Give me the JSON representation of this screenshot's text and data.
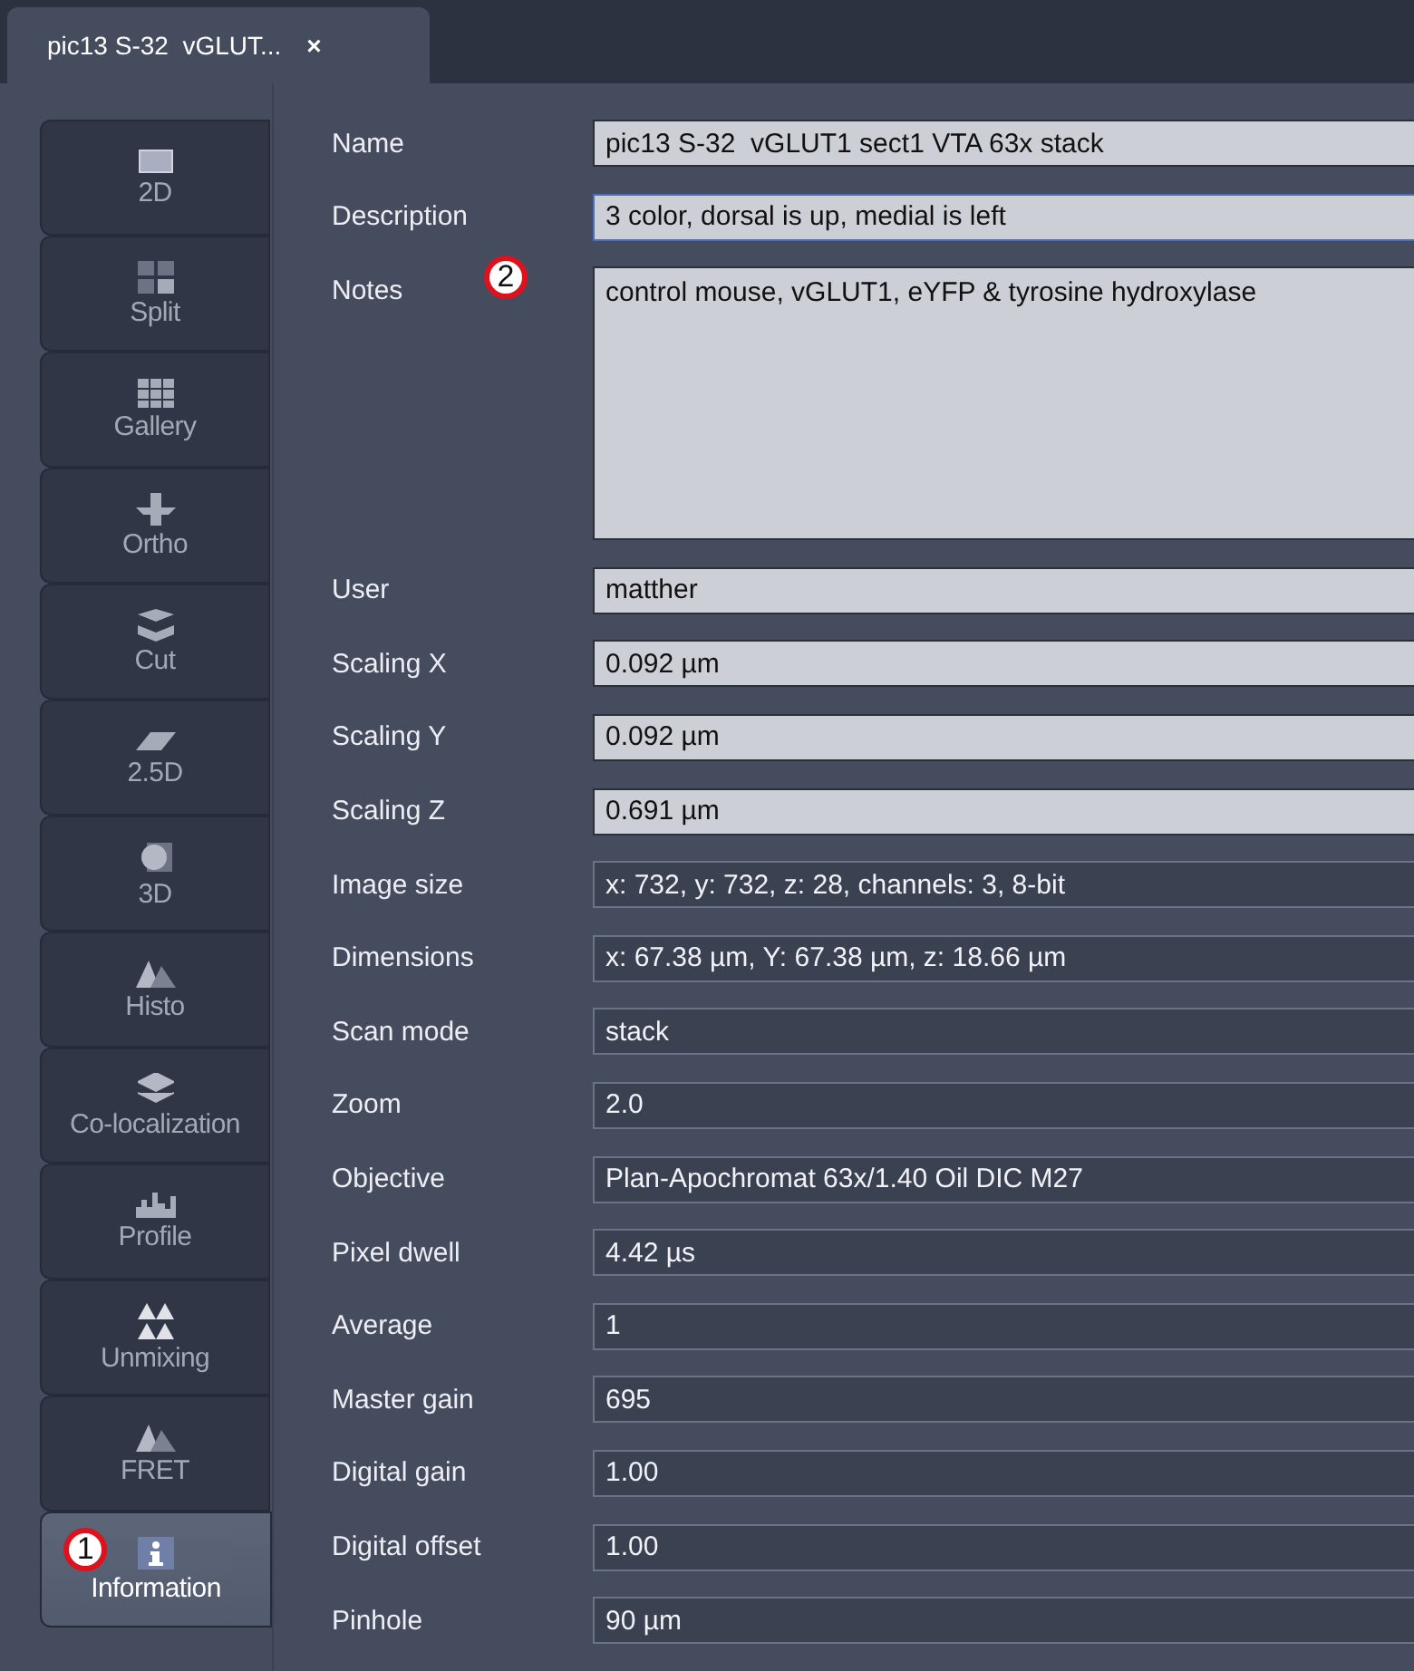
{
  "document_tab": {
    "title": "pic13 S-32  vGLUT...",
    "close": "×"
  },
  "view_tabs": [
    {
      "label": "2D",
      "selected": false
    },
    {
      "label": "Split",
      "selected": false
    },
    {
      "label": "Gallery",
      "selected": false
    },
    {
      "label": "Ortho",
      "selected": false
    },
    {
      "label": "Cut",
      "selected": false
    },
    {
      "label": "2.5D",
      "selected": false
    },
    {
      "label": "3D",
      "selected": false
    },
    {
      "label": "Histo",
      "selected": false
    },
    {
      "label": "Co-localization",
      "selected": false
    },
    {
      "label": "Profile",
      "selected": false
    },
    {
      "label": "Unmixing",
      "selected": false
    },
    {
      "label": "FRET",
      "selected": false
    },
    {
      "label": "Information",
      "selected": true,
      "callout": "1"
    }
  ],
  "fields": [
    {
      "label": "Name",
      "value": "pic13 S-32  vGLUT1 sect1 VTA 63x stack",
      "kind": "editable"
    },
    {
      "label": "Description",
      "value": "3 color, dorsal is up, medial is left",
      "kind": "editable",
      "focused": true
    },
    {
      "label": "Notes",
      "value": "control mouse, vGLUT1, eYFP & tyrosine hydroxylase",
      "kind": "multiline",
      "callout": "2"
    },
    {
      "label": "User",
      "value": "matther",
      "kind": "editable"
    },
    {
      "label": "Scaling X",
      "value": "0.092 µm",
      "kind": "editable"
    },
    {
      "label": "Scaling Y",
      "value": "0.092 µm",
      "kind": "editable"
    },
    {
      "label": "Scaling Z",
      "value": "0.691 µm",
      "kind": "editable"
    },
    {
      "label": "Image size",
      "value": "x: 732, y: 732, z: 28, channels: 3, 8-bit",
      "kind": "readonly"
    },
    {
      "label": "Dimensions",
      "value": "x: 67.38 µm, Y: 67.38 µm, z: 18.66 µm",
      "kind": "readonly"
    },
    {
      "label": "Scan mode",
      "value": "stack",
      "kind": "readonly"
    },
    {
      "label": "Zoom",
      "value": "2.0",
      "kind": "readonly"
    },
    {
      "label": "Objective",
      "value": "Plan-Apochromat 63x/1.40 Oil DIC M27",
      "kind": "readonly"
    },
    {
      "label": "Pixel dwell",
      "value": "4.42 µs",
      "kind": "readonly"
    },
    {
      "label": "Average",
      "value": "1",
      "kind": "readonly"
    },
    {
      "label": "Master gain",
      "value": "695",
      "kind": "readonly"
    },
    {
      "label": "Digital gain",
      "value": "1.00",
      "kind": "readonly"
    },
    {
      "label": "Digital offset",
      "value": "1.00",
      "kind": "readonly"
    },
    {
      "label": "Pinhole",
      "value": "90 µm",
      "kind": "readonly"
    }
  ]
}
